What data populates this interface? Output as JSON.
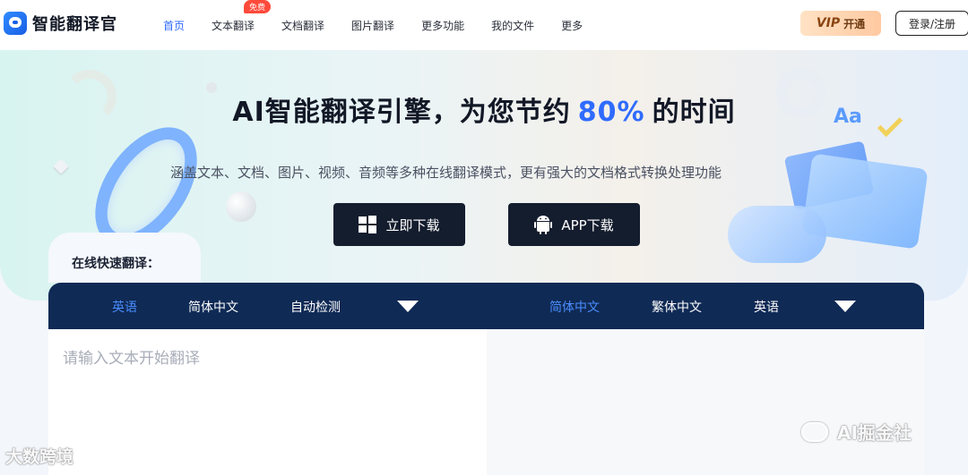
{
  "header": {
    "brand": "智能翻译官",
    "nav": [
      {
        "label": "首页",
        "active": true
      },
      {
        "label": "文本翻译",
        "badge": "免费"
      },
      {
        "label": "文档翻译"
      },
      {
        "label": "图片翻译"
      },
      {
        "label": "更多功能"
      },
      {
        "label": "我的文件"
      },
      {
        "label": "更多"
      }
    ],
    "vip_mark": "VIP",
    "vip_label": "开通",
    "login_label": "登录/注册"
  },
  "hero": {
    "title_pre": "AI智能翻译引擎，为您节约",
    "title_pct": "80%",
    "title_post": "的时间",
    "subtitle": "涵盖文本、文档、图片、视频、音频等多种在线翻译模式，更有强大的文档格式转换处理功能",
    "btn_windows": "立即下载",
    "btn_app": "APP下载",
    "deco_text": "Aa"
  },
  "translator": {
    "tab_label": "在线快速翻译：",
    "source_langs": [
      "英语",
      "简体中文",
      "自动检测"
    ],
    "target_langs": [
      "简体中文",
      "繁体中文",
      "英语"
    ],
    "source_placeholder": "请输入文本开始翻译"
  },
  "watermarks": {
    "left": "大数跨境",
    "right": "AI掘金社"
  },
  "colors": {
    "accent": "#2f6bff",
    "lang_bar": "#0f2a55",
    "button_dark": "#141d2e"
  }
}
